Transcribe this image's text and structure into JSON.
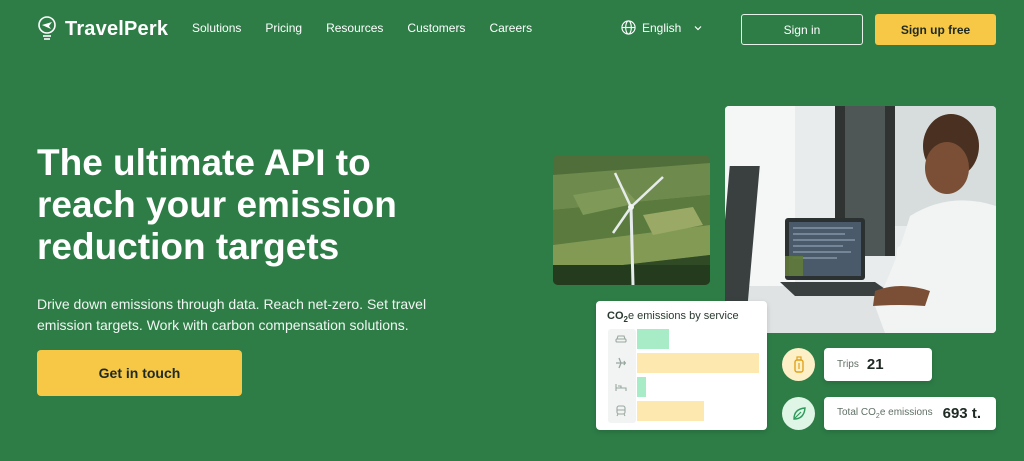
{
  "brand": {
    "name": "TravelPerk",
    "accent": "#2e7d47",
    "cta_color": "#f6c845"
  },
  "nav": {
    "links": [
      "Solutions",
      "Pricing",
      "Resources",
      "Customers",
      "Careers"
    ],
    "language": "English",
    "sign_in": "Sign in",
    "sign_up": "Sign up free"
  },
  "hero": {
    "title": "The ultimate API to reach your emission reduction targets",
    "subtitle": "Drive down emissions through data. Reach net-zero. Set travel emission targets. Work with carbon compensation solutions.",
    "cta": "Get in touch"
  },
  "emissions_card": {
    "title_prefix": "CO",
    "title_sub": "2",
    "title_rest": "e emissions by service",
    "rows": [
      {
        "icon": "car-icon",
        "value": 0.26,
        "color": "#a8ecc7"
      },
      {
        "icon": "plane-icon",
        "value": 1.0,
        "color": "#fde9b0"
      },
      {
        "icon": "bed-icon",
        "value": 0.07,
        "color": "#a8ecc7"
      },
      {
        "icon": "train-icon",
        "value": 0.55,
        "color": "#fde9b0"
      }
    ]
  },
  "stats": {
    "trips_label": "Trips",
    "trips_value": "21",
    "emissions_label_prefix": "Total CO",
    "emissions_label_sub": "2",
    "emissions_label_rest": "e emissions",
    "emissions_value": "693 t."
  }
}
